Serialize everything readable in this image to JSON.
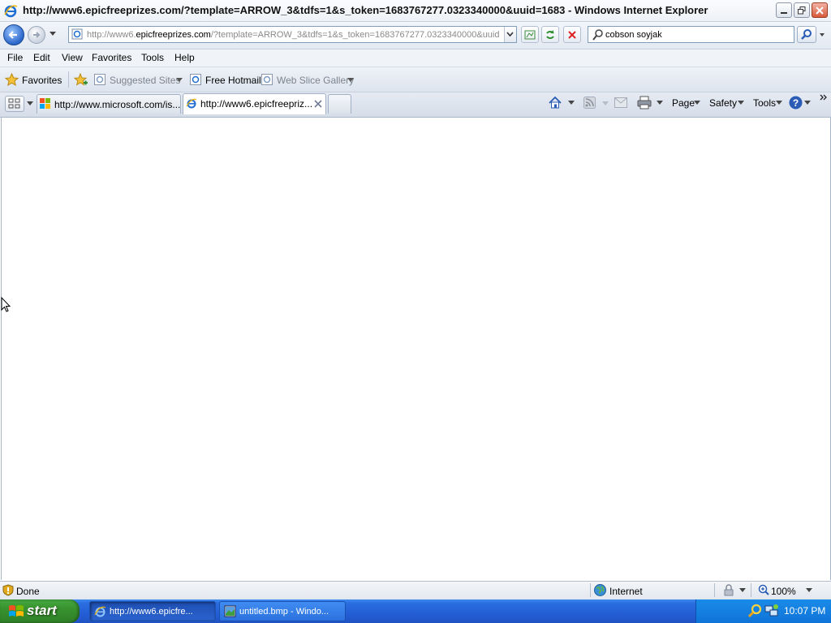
{
  "window": {
    "title": "http://www6.epicfreeprizes.com/?template=ARROW_3&tdfs=1&s_token=1683767277.0323340000&uuid=1683 - Windows Internet Explorer"
  },
  "address_bar": {
    "url_prefix": "http://www6.",
    "url_domain": "epicfreeprizes.com",
    "url_rest": "/?template=ARROW_3&tdfs=1&s_token=1683767277.0323340000&uuid",
    "search_value": "cobson soyjak"
  },
  "menu": [
    "File",
    "Edit",
    "View",
    "Favorites",
    "Tools",
    "Help"
  ],
  "favorites_bar": {
    "favorites_label": "Favorites",
    "items": [
      "Suggested Sites",
      "Free Hotmail",
      "Web Slice Gallery"
    ]
  },
  "tabs": [
    {
      "label": "http://www.microsoft.com/is..."
    },
    {
      "label": "http://www6.epicfreepriz..."
    }
  ],
  "command_bar": {
    "page": "Page",
    "safety": "Safety",
    "tools": "Tools"
  },
  "status_bar": {
    "status": "Done",
    "zone": "Internet",
    "zoom": "100%"
  },
  "taskbar": {
    "start_label": "start",
    "buttons": [
      {
        "label": "http://www6.epicfre..."
      },
      {
        "label": "untitled.bmp - Windo..."
      }
    ],
    "clock": "10:07 PM"
  },
  "colors": {
    "taskbar_blue": "#245ed6",
    "start_green": "#38922f",
    "tray_blue": "#0f74d8"
  }
}
